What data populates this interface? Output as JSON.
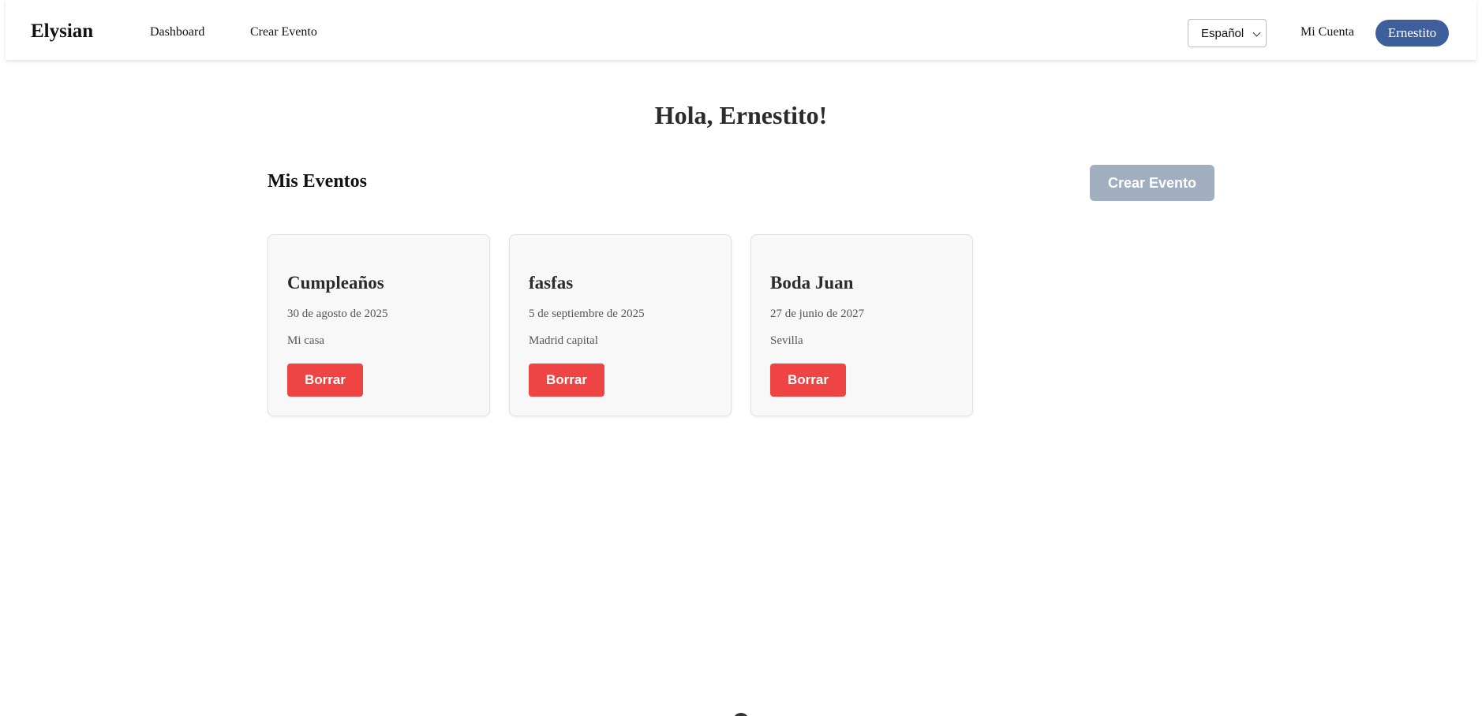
{
  "navbar": {
    "brand": "Elysian",
    "links": [
      {
        "label": "Dashboard"
      },
      {
        "label": "Crear Evento"
      }
    ],
    "language": {
      "selected": "Español"
    },
    "account_label": "Mi Cuenta",
    "user_name": "Ernestito"
  },
  "main": {
    "greeting": "Hola, Ernestito!",
    "section_title": "Mis Eventos",
    "create_button_label": "Crear Evento",
    "events": [
      {
        "title": "Cumpleaños",
        "date": "30 de agosto de 2025",
        "location": "Mi casa",
        "delete_label": "Borrar"
      },
      {
        "title": "fasfas",
        "date": "5 de septiembre de 2025",
        "location": "Madrid capital",
        "delete_label": "Borrar"
      },
      {
        "title": "Boda Juan",
        "date": "27 de junio de 2027",
        "location": "Sevilla",
        "delete_label": "Borrar"
      }
    ]
  },
  "colors": {
    "user_pill": "#3e5f9c",
    "create_button": "#a0aec0",
    "delete_button": "#ef4444",
    "card_background": "#f8f8f8"
  },
  "icons": {
    "language_dropdown": "chevron-down-icon"
  }
}
